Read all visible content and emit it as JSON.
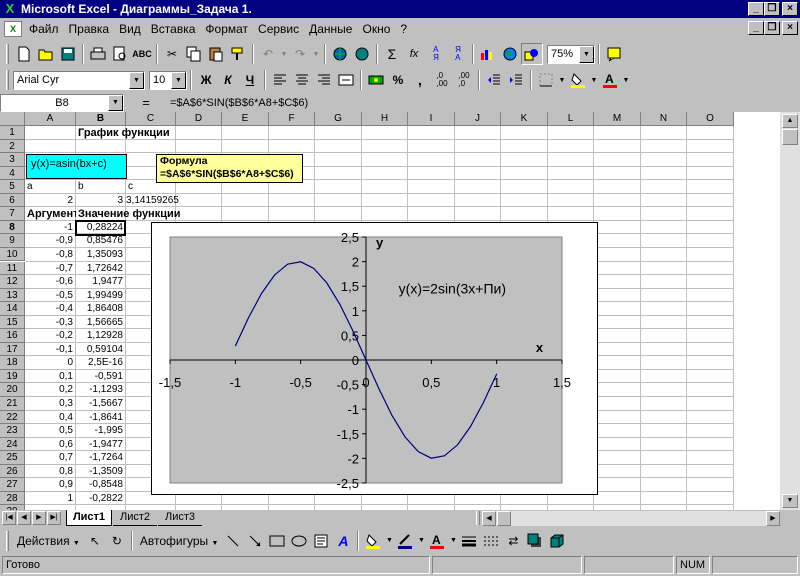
{
  "window": {
    "title": "Microsoft Excel - Диаграммы_Задача 1."
  },
  "menu": [
    "Файл",
    "Правка",
    "Вид",
    "Вставка",
    "Формат",
    "Сервис",
    "Данные",
    "Окно",
    "?"
  ],
  "toolbar": {
    "zoom": "75%"
  },
  "format": {
    "font": "Arial Cyr",
    "size": "10",
    "bold": "Ж",
    "italic": "К",
    "underline": "Ч",
    "percent": "%",
    "comma": ","
  },
  "formula": {
    "cell_ref": "B8",
    "equals": "=",
    "content": "=$A$6*SIN($B$6*A8+$C$6)"
  },
  "columns": [
    "A",
    "B",
    "C",
    "D",
    "E",
    "F",
    "G",
    "H",
    "I",
    "J",
    "K",
    "L",
    "M",
    "N",
    "O"
  ],
  "rows": [
    "1",
    "2",
    "3",
    "4",
    "5",
    "6",
    "7",
    "8",
    "9",
    "10",
    "11",
    "12",
    "13",
    "14",
    "15",
    "16",
    "17",
    "18",
    "19",
    "20",
    "21",
    "22",
    "23",
    "24",
    "25",
    "26",
    "27",
    "28",
    "29"
  ],
  "sheet": {
    "title": "График функции",
    "formula_label": "y(x)=asin(bx+c)",
    "note_title": "Формула",
    "note_formula": "=$A$6*SIN($B$6*A8+$C$6)",
    "param_labels": [
      "a",
      "b",
      "c"
    ],
    "param_values": [
      "2",
      "3",
      "3,14159265"
    ],
    "header_arg": "Аргумент",
    "header_val": "Значение функции",
    "args": [
      "-1",
      "-0,9",
      "-0,8",
      "-0,7",
      "-0,6",
      "-0,5",
      "-0,4",
      "-0,3",
      "-0,2",
      "-0,1",
      "0",
      "0,1",
      "0,2",
      "0,3",
      "0,4",
      "0,5",
      "0,6",
      "0,7",
      "0,8",
      "0,9",
      "1"
    ],
    "vals": [
      "0,28224",
      "0,85476",
      "1,35093",
      "1,72642",
      "1,9477",
      "1,99499",
      "1,86408",
      "1,56665",
      "1,12928",
      "0,59104",
      "2,5E-16",
      "-0,591",
      "-1,1293",
      "-1,5667",
      "-1,8641",
      "-1,995",
      "-1,9477",
      "-1,7264",
      "-1,3509",
      "-0,8548",
      "-0,2822"
    ]
  },
  "chart_data": {
    "type": "scatter",
    "title": "",
    "annotation": "y(x)=2sin(3x+Пи)",
    "xlabel": "x",
    "ylabel": "y",
    "xlim": [
      -1.5,
      1.5
    ],
    "ylim": [
      -2.5,
      2.5
    ],
    "xticks": [
      "-1,5",
      "-1",
      "-0,5",
      "0",
      "0,5",
      "1",
      "1,5"
    ],
    "yticks": [
      "2,5",
      "2",
      "1,5",
      "1",
      "0,5",
      "0",
      "-0,5",
      "-1",
      "-1,5",
      "-2",
      "-2,5"
    ],
    "x": [
      -1,
      -0.9,
      -0.8,
      -0.7,
      -0.6,
      -0.5,
      -0.4,
      -0.3,
      -0.2,
      -0.1,
      0,
      0.1,
      0.2,
      0.3,
      0.4,
      0.5,
      0.6,
      0.7,
      0.8,
      0.9,
      1
    ],
    "y": [
      0.28224,
      0.85476,
      1.35093,
      1.72642,
      1.9477,
      1.99499,
      1.86408,
      1.56665,
      1.12928,
      0.59104,
      0,
      -0.591,
      -1.1293,
      -1.5667,
      -1.8641,
      -1.995,
      -1.9477,
      -1.7264,
      -1.3509,
      -0.8548,
      -0.2822
    ],
    "grid": false,
    "plot_color": "#c0c0c0",
    "line_color": "#000080"
  },
  "tabs": [
    "Лист1",
    "Лист2",
    "Лист3"
  ],
  "drawing": {
    "actions": "Действия",
    "autoshapes": "Автофигуры"
  },
  "status": {
    "ready": "Готово",
    "num": "NUM"
  },
  "colors": {
    "titlebar": "#000080",
    "formula_label_bg": "#00ffff",
    "note_bg": "#ffff99"
  }
}
